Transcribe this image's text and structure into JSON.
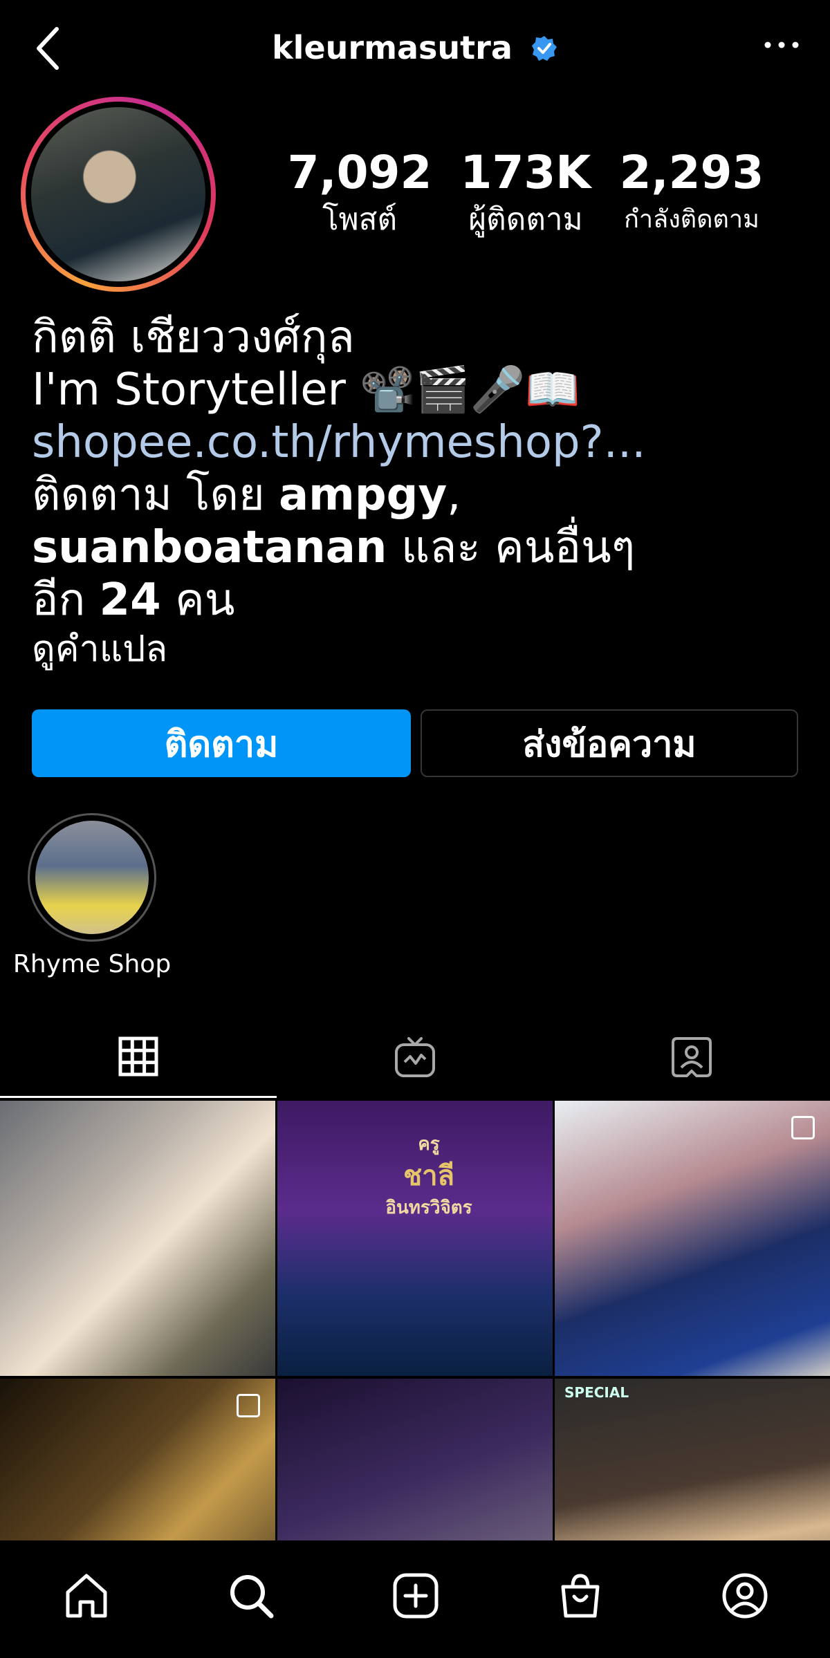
{
  "header": {
    "username": "kleurmasutra",
    "verified": true
  },
  "stats": [
    {
      "value": "7,092",
      "label": "โพสต์"
    },
    {
      "value": "173K",
      "label": "ผู้ติดตาม"
    },
    {
      "value": "2,293",
      "label": "กำลังติดตาม"
    }
  ],
  "bio": {
    "name": "กิตติ เชียววงศ์กุล",
    "tagline": "I'm Storyteller 📽️🎬🎤📖",
    "link": "shopee.co.th/rhymeshop?...",
    "followed_by_prefix": "ติดตาม โดย ",
    "followed_by_user1": "ampgy",
    "followed_by_comma": ",",
    "followed_by_user2": "suanboatanan",
    "followed_by_and_others": " และ คนอื่นๆ",
    "followed_by_count_prefix": "อีก ",
    "followed_by_count": "24",
    "followed_by_count_suffix": " คน",
    "translate": "ดูคำแปล"
  },
  "actions": {
    "follow_label": "ติดตาม",
    "message_label": "ส่งข้อความ"
  },
  "highlights": [
    {
      "label": "Rhyme Shop"
    }
  ],
  "tabs": [
    {
      "icon": "grid-icon"
    },
    {
      "icon": "igtv-icon"
    },
    {
      "icon": "tagged-icon"
    }
  ],
  "posts": [
    {
      "multi": false
    },
    {
      "multi": false,
      "caption_line1": "ครู",
      "caption_line2": "ชาลี",
      "caption_line3": "อินทรวิจิตร"
    },
    {
      "multi": true
    },
    {
      "multi": true
    },
    {
      "multi": false
    },
    {
      "multi": false,
      "tag": "SPECIAL"
    }
  ],
  "colors": {
    "accent": "#0095f6",
    "link": "#b3cbe8",
    "verified": "#3897f0"
  },
  "nav": [
    "home-icon",
    "search-icon",
    "new-post-icon",
    "shop-icon",
    "profile-icon"
  ]
}
